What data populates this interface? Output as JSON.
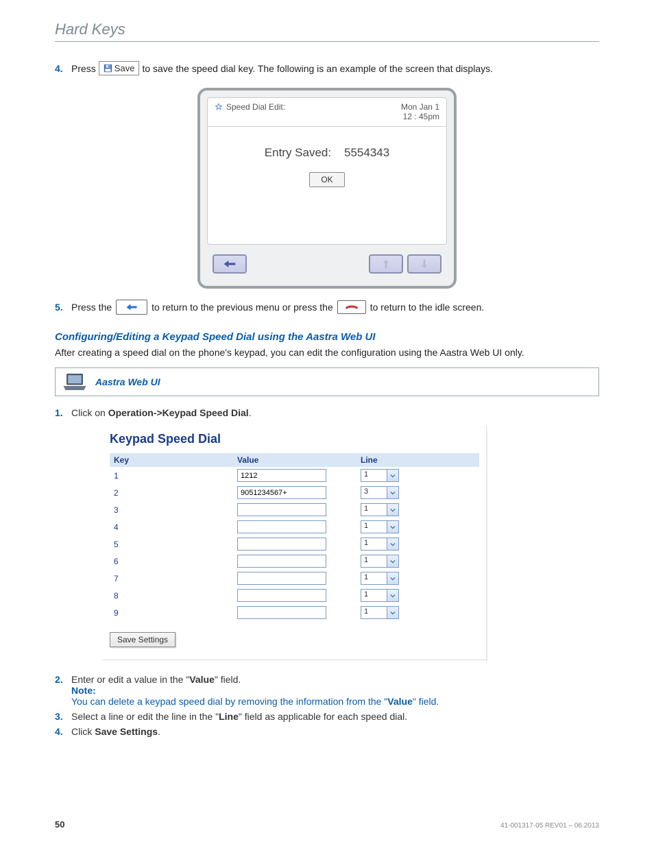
{
  "page_title": "Hard Keys",
  "step4": {
    "num": "4.",
    "prefix": "Press",
    "save_label": "Save",
    "suffix": "to save the speed dial key. The following is an example of the screen that displays."
  },
  "phone": {
    "header_title": "Speed Dial Edit:",
    "date": "Mon Jan 1",
    "time": "12 : 45pm",
    "entry_label": "Entry Saved:",
    "entry_value": "5554343",
    "ok": "OK"
  },
  "step5": {
    "num": "5.",
    "prefix": "Press the",
    "mid": "to return to the previous menu or press the",
    "suffix": "to return to the idle screen."
  },
  "section_heading": "Configuring/Editing a Keypad Speed Dial using the Aastra Web UI",
  "section_body": "After creating a speed dial on the phone's keypad, you can edit the configuration using the Aastra Web UI only.",
  "webui_label": "Aastra Web UI",
  "step_web1": {
    "num": "1.",
    "prefix": "Click on ",
    "bold": "Operation->Keypad Speed Dial",
    "suffix": "."
  },
  "panel": {
    "title": "Keypad Speed Dial",
    "headers": {
      "key": "Key",
      "value": "Value",
      "line": "Line"
    },
    "rows": [
      {
        "key": "1",
        "value": "1212",
        "line": "1"
      },
      {
        "key": "2",
        "value": "9051234567+",
        "line": "3"
      },
      {
        "key": "3",
        "value": "",
        "line": "1"
      },
      {
        "key": "4",
        "value": "",
        "line": "1"
      },
      {
        "key": "5",
        "value": "",
        "line": "1"
      },
      {
        "key": "6",
        "value": "",
        "line": "1"
      },
      {
        "key": "7",
        "value": "",
        "line": "1"
      },
      {
        "key": "8",
        "value": "",
        "line": "1"
      },
      {
        "key": "9",
        "value": "",
        "line": "1"
      }
    ],
    "save": "Save Settings"
  },
  "step_web2": {
    "num": "2.",
    "t1": "Enter or edit a value in the \"",
    "b1": "Value",
    "t2": "\" field.",
    "note_label": "Note:",
    "note_t1": "You can delete a keypad speed dial by removing the information from the \"",
    "note_b1": "Value",
    "note_t2": "\" field."
  },
  "step_web3": {
    "num": "3.",
    "t1": "Select a line or edit the line in the \"",
    "b1": "Line",
    "t2": "\" field as applicable for each speed dial."
  },
  "step_web4": {
    "num": "4.",
    "t1": "Click ",
    "b1": "Save Settings",
    "t2": "."
  },
  "footer": {
    "page": "50",
    "rev": "41-001317-05 REV01 – 06.2013"
  }
}
